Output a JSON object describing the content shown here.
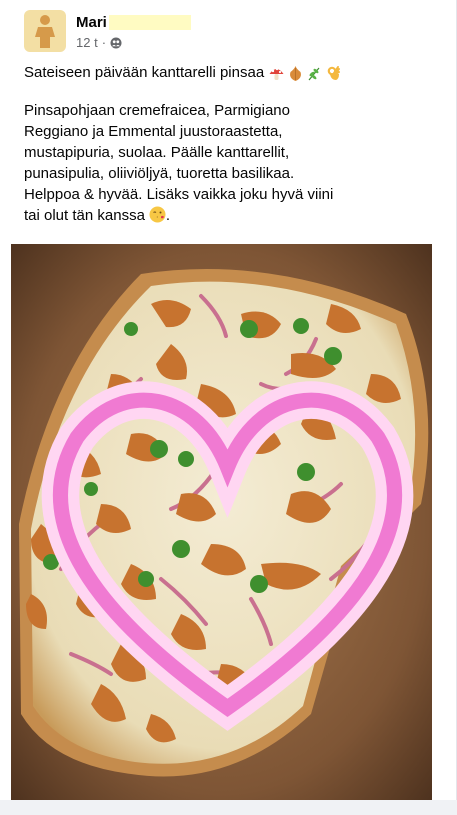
{
  "post": {
    "author": "Mari",
    "time": "12 t",
    "separator": "·",
    "privacy_icon": "friends-icon",
    "title": "Sateiseen päivään kanttarelli pinsaa",
    "title_emojis": [
      "mushroom-emoji",
      "onion-emoji",
      "herb-emoji",
      "ok-hand-emoji"
    ],
    "body": "Pinsapohjaan cremefraicea, Parmigiano\nReggiano ja Emmental juustoraastetta,\nmustapipuria, suolaa. Päälle kanttarellit,\npunasipulia, oliiviöljyä, tuoretta basilikaa.\nHelppoa & hyvää. Lisäks vaikka joku hyvä viini\ntai olut tän kanssa",
    "body_end_emoji": "kissing-face-emoji",
    "body_end_punct": ".",
    "photo_icon": "heart-sticker-icon"
  },
  "colors": {
    "text": "#050505",
    "secondary": "#65676b",
    "avatar_bg": "#f3dfa4",
    "redaction": "#fffbc2"
  }
}
